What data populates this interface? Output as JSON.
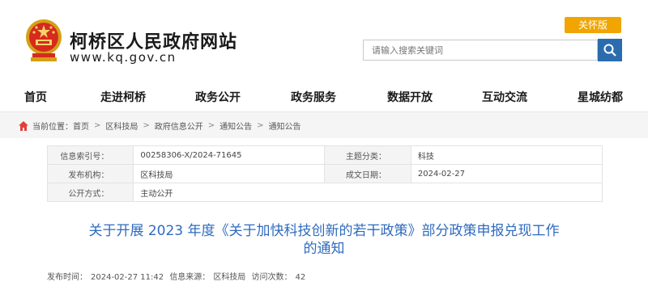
{
  "site": {
    "title": "柯桥区人民政府网站",
    "url": "www.kq.gov.cn",
    "care_button": "关怀版",
    "search_placeholder": "请输入搜索关键词",
    "colors": {
      "accent": "#2b6cae",
      "care": "#f0a500",
      "title": "#2f6bbf"
    }
  },
  "nav": {
    "items": [
      "首页",
      "走进柯桥",
      "政务公开",
      "政务服务",
      "数据开放",
      "互动交流",
      "星城纺都"
    ]
  },
  "breadcrumb": {
    "label": "当前位置：",
    "items": [
      "首页",
      "区科技局",
      "政府信息公开",
      "通知公告",
      "通知公告"
    ]
  },
  "info": {
    "index_label": "信息索引号：",
    "index_value": "00258306-X/2024-71645",
    "topic_label": "主题分类：",
    "topic_value": "科技",
    "org_label": "发布机构：",
    "org_value": "区科技局",
    "date_label": "成文日期：",
    "date_value": "2024-02-27",
    "mode_label": "公开方式：",
    "mode_value": "主动公开"
  },
  "article": {
    "title_line1": "关于开展 2023 年度《关于加快科技创新的若干政策》部分政策申报兑现工作",
    "title_line2": "的通知",
    "meta": {
      "publish_label": "发布时间：",
      "publish_value": "2024-02-27 11:42",
      "source_label": "信息来源：",
      "source_value": "区科技局",
      "visits_label": "访问次数：",
      "visits_value": "42"
    }
  }
}
